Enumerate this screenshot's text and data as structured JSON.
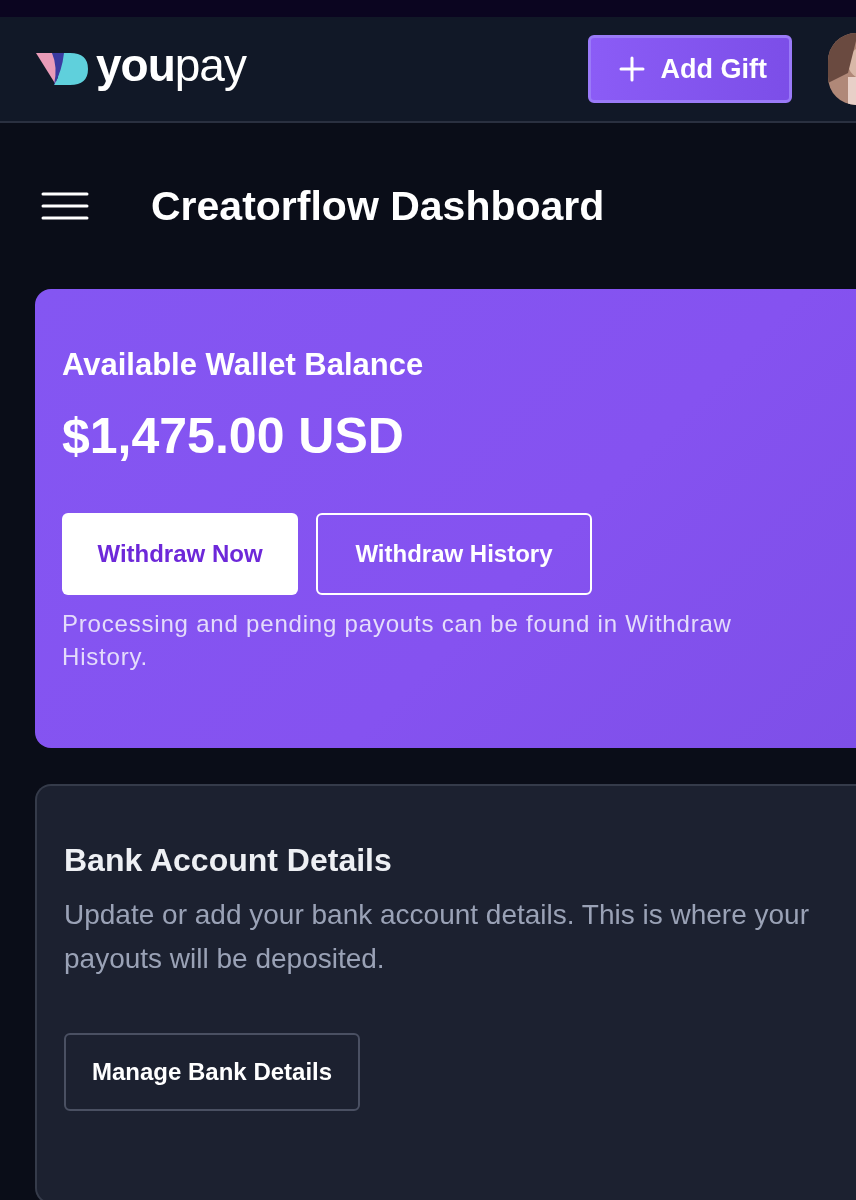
{
  "header": {
    "logo": "**you**pay",
    "add_button": "Add Gift"
  },
  "page": {
    "title": "Creatorflow Dashboard"
  },
  "wallet": {
    "title": "Available Wallet Balance",
    "amount": "$1,475.00 USD",
    "buttons": [
      {
        "label": "Withdraw Now",
        "kind": "primary"
      },
      {
        "label": "Withdraw History",
        "kind": "outline"
      }
    ],
    "note": "Processing and pending payouts can be found in Withdraw History."
  },
  "bank": {
    "title": "Bank Account Details",
    "description": "Update or add your bank account details. This is where your payouts will be deposited.",
    "button": "Manage Bank Details"
  }
}
